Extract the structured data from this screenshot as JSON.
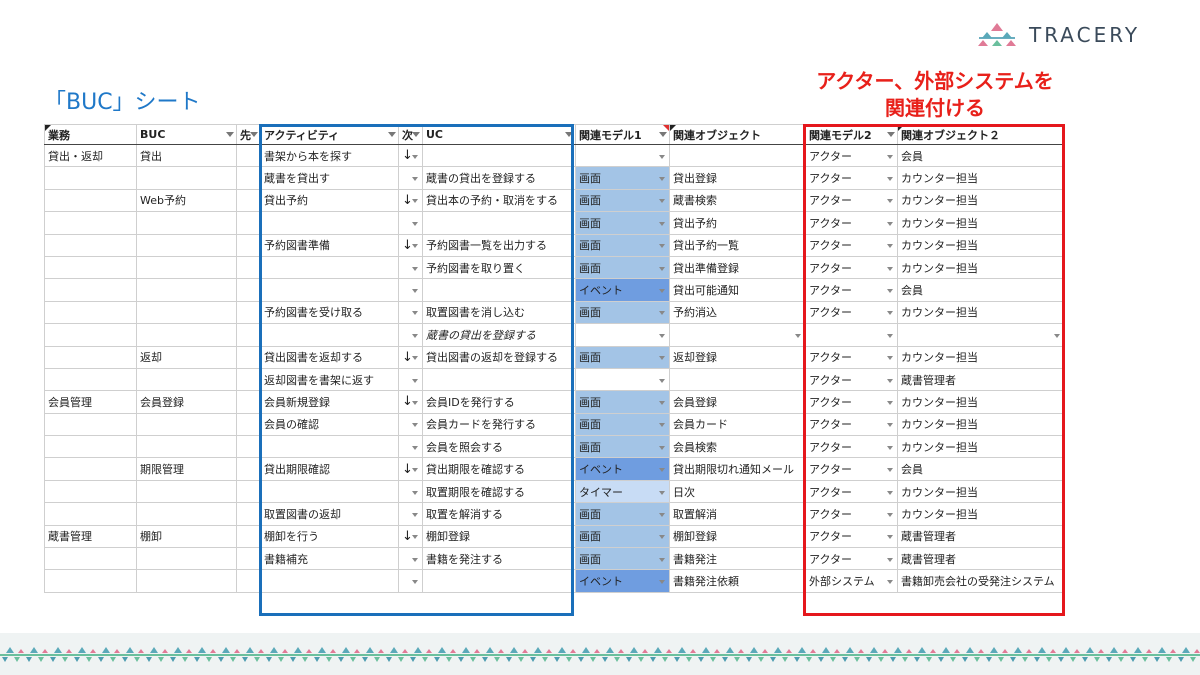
{
  "logo": {
    "text": "TRACERY"
  },
  "title": "「BUC」シート",
  "callout": {
    "line1": "アクター、外部システムを",
    "line2": "関連付ける"
  },
  "columns": [
    "業務",
    "BUC",
    "先",
    "アクティビティ",
    "次",
    "UC",
    "関連モデル1",
    "関連オブジェクト",
    "関連モデル2",
    "関連オブジェクト２"
  ],
  "rows": [
    {
      "gyomu": "貸出・返却",
      "buc": "貸出",
      "activity": "書架から本を探す",
      "next": "↓",
      "uc": "",
      "model1": "",
      "m1type": "blank",
      "object1": "",
      "model2": "アクター",
      "object2": "会員"
    },
    {
      "gyomu": "",
      "buc": "",
      "activity": "蔵書を貸出す",
      "next": "",
      "uc": "蔵書の貸出を登録する",
      "model1": "画面",
      "m1type": "screen",
      "object1": "貸出登録",
      "model2": "アクター",
      "object2": "カウンター担当"
    },
    {
      "gyomu": "",
      "buc": "Web予約",
      "activity": "貸出予約",
      "next": "↓",
      "uc": "貸出本の予約・取消をする",
      "model1": "画面",
      "m1type": "screen",
      "object1": "蔵書検索",
      "model2": "アクター",
      "object2": "カウンター担当"
    },
    {
      "gyomu": "",
      "buc": "",
      "activity": "",
      "next": "",
      "uc": "",
      "model1": "画面",
      "m1type": "screen",
      "object1": "貸出予約",
      "model2": "アクター",
      "object2": "カウンター担当"
    },
    {
      "gyomu": "",
      "buc": "",
      "activity": "予約図書準備",
      "next": "↓",
      "uc": "予約図書一覧を出力する",
      "model1": "画面",
      "m1type": "screen",
      "object1": "貸出予約一覧",
      "model2": "アクター",
      "object2": "カウンター担当"
    },
    {
      "gyomu": "",
      "buc": "",
      "activity": "",
      "next": "",
      "uc": "予約図書を取り置く",
      "model1": "画面",
      "m1type": "screen",
      "object1": "貸出準備登録",
      "model2": "アクター",
      "object2": "カウンター担当"
    },
    {
      "gyomu": "",
      "buc": "",
      "activity": "",
      "next": "",
      "uc": "",
      "model1": "イベント",
      "m1type": "event",
      "object1": "貸出可能通知",
      "model2": "アクター",
      "object2": "会員"
    },
    {
      "gyomu": "",
      "buc": "",
      "activity": "予約図書を受け取る",
      "next": "",
      "uc": "取置図書を消し込む",
      "model1": "画面",
      "m1type": "screen",
      "object1": "予約消込",
      "model2": "アクター",
      "object2": "カウンター担当"
    },
    {
      "gyomu": "",
      "buc": "",
      "activity": "",
      "next": "",
      "uc": "蔵書の貸出を登録する",
      "ucItalic": true,
      "model1": "",
      "m1type": "blank",
      "object1": "",
      "model2": "",
      "object2": ""
    },
    {
      "gyomu": "",
      "buc": "返却",
      "activity": "貸出図書を返却する",
      "next": "↓",
      "uc": "貸出図書の返却を登録する",
      "model1": "画面",
      "m1type": "screen",
      "object1": "返却登録",
      "model2": "アクター",
      "object2": "カウンター担当"
    },
    {
      "gyomu": "",
      "buc": "",
      "activity": "返却図書を書架に返す",
      "next": "",
      "uc": "",
      "model1": "",
      "m1type": "blank",
      "object1": "",
      "model2": "アクター",
      "object2": "蔵書管理者"
    },
    {
      "gyomu": "会員管理",
      "buc": "会員登録",
      "activity": "会員新規登録",
      "next": "↓",
      "uc": "会員IDを発行する",
      "model1": "画面",
      "m1type": "screen",
      "object1": "会員登録",
      "model2": "アクター",
      "object2": "カウンター担当"
    },
    {
      "gyomu": "",
      "buc": "",
      "activity": "会員の確認",
      "next": "",
      "uc": "会員カードを発行する",
      "model1": "画面",
      "m1type": "screen",
      "object1": "会員カード",
      "model2": "アクター",
      "object2": "カウンター担当"
    },
    {
      "gyomu": "",
      "buc": "",
      "activity": "",
      "next": "",
      "uc": "会員を照会する",
      "model1": "画面",
      "m1type": "screen",
      "object1": "会員検索",
      "model2": "アクター",
      "object2": "カウンター担当"
    },
    {
      "gyomu": "",
      "buc": "期限管理",
      "activity": "貸出期限確認",
      "next": "↓",
      "uc": "貸出期限を確認する",
      "model1": "イベント",
      "m1type": "event",
      "object1": "貸出期限切れ通知メール",
      "model2": "アクター",
      "object2": "会員"
    },
    {
      "gyomu": "",
      "buc": "",
      "activity": "",
      "next": "",
      "uc": "取置期限を確認する",
      "model1": "タイマー",
      "m1type": "timer",
      "object1": "日次",
      "model2": "アクター",
      "object2": "カウンター担当"
    },
    {
      "gyomu": "",
      "buc": "",
      "activity": "取置図書の返却",
      "next": "",
      "uc": "取置を解消する",
      "model1": "画面",
      "m1type": "screen",
      "object1": "取置解消",
      "model2": "アクター",
      "object2": "カウンター担当"
    },
    {
      "gyomu": "蔵書管理",
      "buc": "棚卸",
      "activity": "棚卸を行う",
      "next": "↓",
      "uc": "棚卸登録",
      "model1": "画面",
      "m1type": "screen",
      "object1": "棚卸登録",
      "model2": "アクター",
      "object2": "蔵書管理者"
    },
    {
      "gyomu": "",
      "buc": "",
      "activity": "書籍補充",
      "next": "",
      "uc": "書籍を発注する",
      "model1": "画面",
      "m1type": "screen",
      "object1": "書籍発注",
      "model2": "アクター",
      "object2": "蔵書管理者"
    },
    {
      "gyomu": "",
      "buc": "",
      "activity": "",
      "next": "",
      "uc": "",
      "model1": "イベント",
      "m1type": "event",
      "object1": "書籍発注依頼",
      "model2": "外部システム",
      "object2": "書籍卸売会社の受発注システム"
    }
  ],
  "colors": {
    "title": "#1f78c8",
    "callout": "#e8201a",
    "screen": "#a3c4e6",
    "event": "#6f9de0",
    "timer": "#c8dcf5",
    "blueHighlight": "#1a6fba",
    "redHighlight": "#e5171c"
  }
}
